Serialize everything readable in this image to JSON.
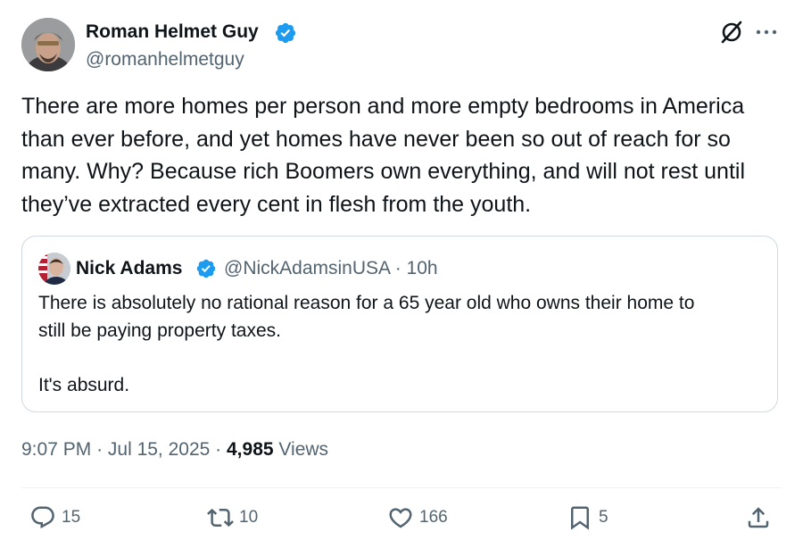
{
  "author": {
    "name": "Roman Helmet Guy",
    "handle": "@romanhelmetguy"
  },
  "tweet": {
    "text": "There are more homes per person and more empty bedrooms in America\nthan ever before, and yet homes have never been so out of reach for so\nmany. Why? Because rich Boomers own everything, and will not rest until\nthey’ve extracted every cent in flesh from the youth."
  },
  "quote": {
    "name": "Nick Adams",
    "handle": "@NickAdamsinUSA",
    "age": "10h",
    "text": "There is absolutely no rational reason for a 65 year old who owns their home to\nstill be paying property taxes.\n\nIt's absurd."
  },
  "meta": {
    "time": "9:07 PM",
    "date": "Jul 15, 2025",
    "views_count": "4,985",
    "views_label": "Views"
  },
  "actions": {
    "replies": "15",
    "reposts": "10",
    "likes": "166",
    "bookmarks": "5"
  },
  "colors": {
    "verified": "#1d9bf0",
    "text": "#0f1419",
    "secondary": "#536471",
    "border": "#cfd9de"
  },
  "icons": [
    "verified-badge-icon",
    "grok-icon",
    "more-icon",
    "reply-icon",
    "retweet-icon",
    "like-icon",
    "bookmark-icon",
    "share-icon"
  ]
}
